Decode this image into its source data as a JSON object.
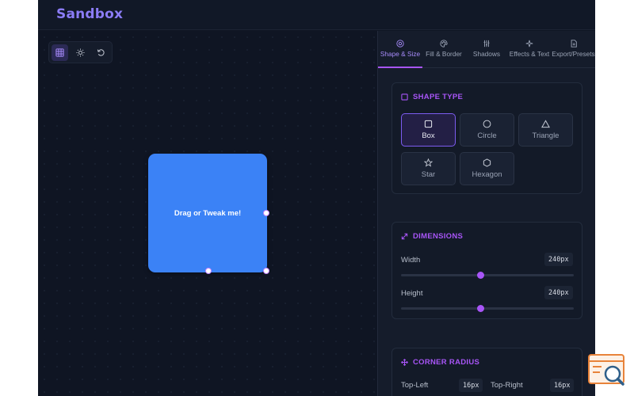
{
  "app": {
    "title": "Sandbox"
  },
  "toolbar": {
    "tools": [
      {
        "icon": "grid-icon",
        "active": true
      },
      {
        "icon": "sun-icon",
        "active": false
      },
      {
        "icon": "reset-icon",
        "active": false
      }
    ]
  },
  "canvas": {
    "shape": {
      "label": "Drag or Tweak me!",
      "color": "#3b82f6"
    }
  },
  "panel": {
    "tabs": [
      {
        "label": "Shape & Size",
        "icon": "target-icon",
        "active": true
      },
      {
        "label": "Fill & Border",
        "icon": "palette-icon",
        "active": false
      },
      {
        "label": "Shadows",
        "icon": "sliders-icon",
        "active": false
      },
      {
        "label": "Effects & Text",
        "icon": "sparkle-icon",
        "active": false
      },
      {
        "label": "Export/Presets",
        "icon": "file-icon",
        "active": false
      }
    ],
    "shape_type": {
      "title": "SHAPE TYPE",
      "options": [
        {
          "label": "Box",
          "icon": "square-icon",
          "active": true
        },
        {
          "label": "Circle",
          "icon": "circle-icon",
          "active": false
        },
        {
          "label": "Triangle",
          "icon": "triangle-icon",
          "active": false
        },
        {
          "label": "Star",
          "icon": "star-icon",
          "active": false
        },
        {
          "label": "Hexagon",
          "icon": "hexagon-icon",
          "active": false
        }
      ]
    },
    "dimensions": {
      "title": "DIMENSIONS",
      "width": {
        "label": "Width",
        "value": "240px",
        "fraction": 0.46
      },
      "height": {
        "label": "Height",
        "value": "240px",
        "fraction": 0.46
      }
    },
    "corner_radius": {
      "title": "CORNER RADIUS",
      "top_left": {
        "label": "Top-Left",
        "value": "16px"
      },
      "top_right": {
        "label": "Top-Right",
        "value": "16px"
      }
    }
  },
  "colors": {
    "accent": "#a855f7",
    "brand": "#8b7cf6",
    "background": "#0f1523"
  }
}
